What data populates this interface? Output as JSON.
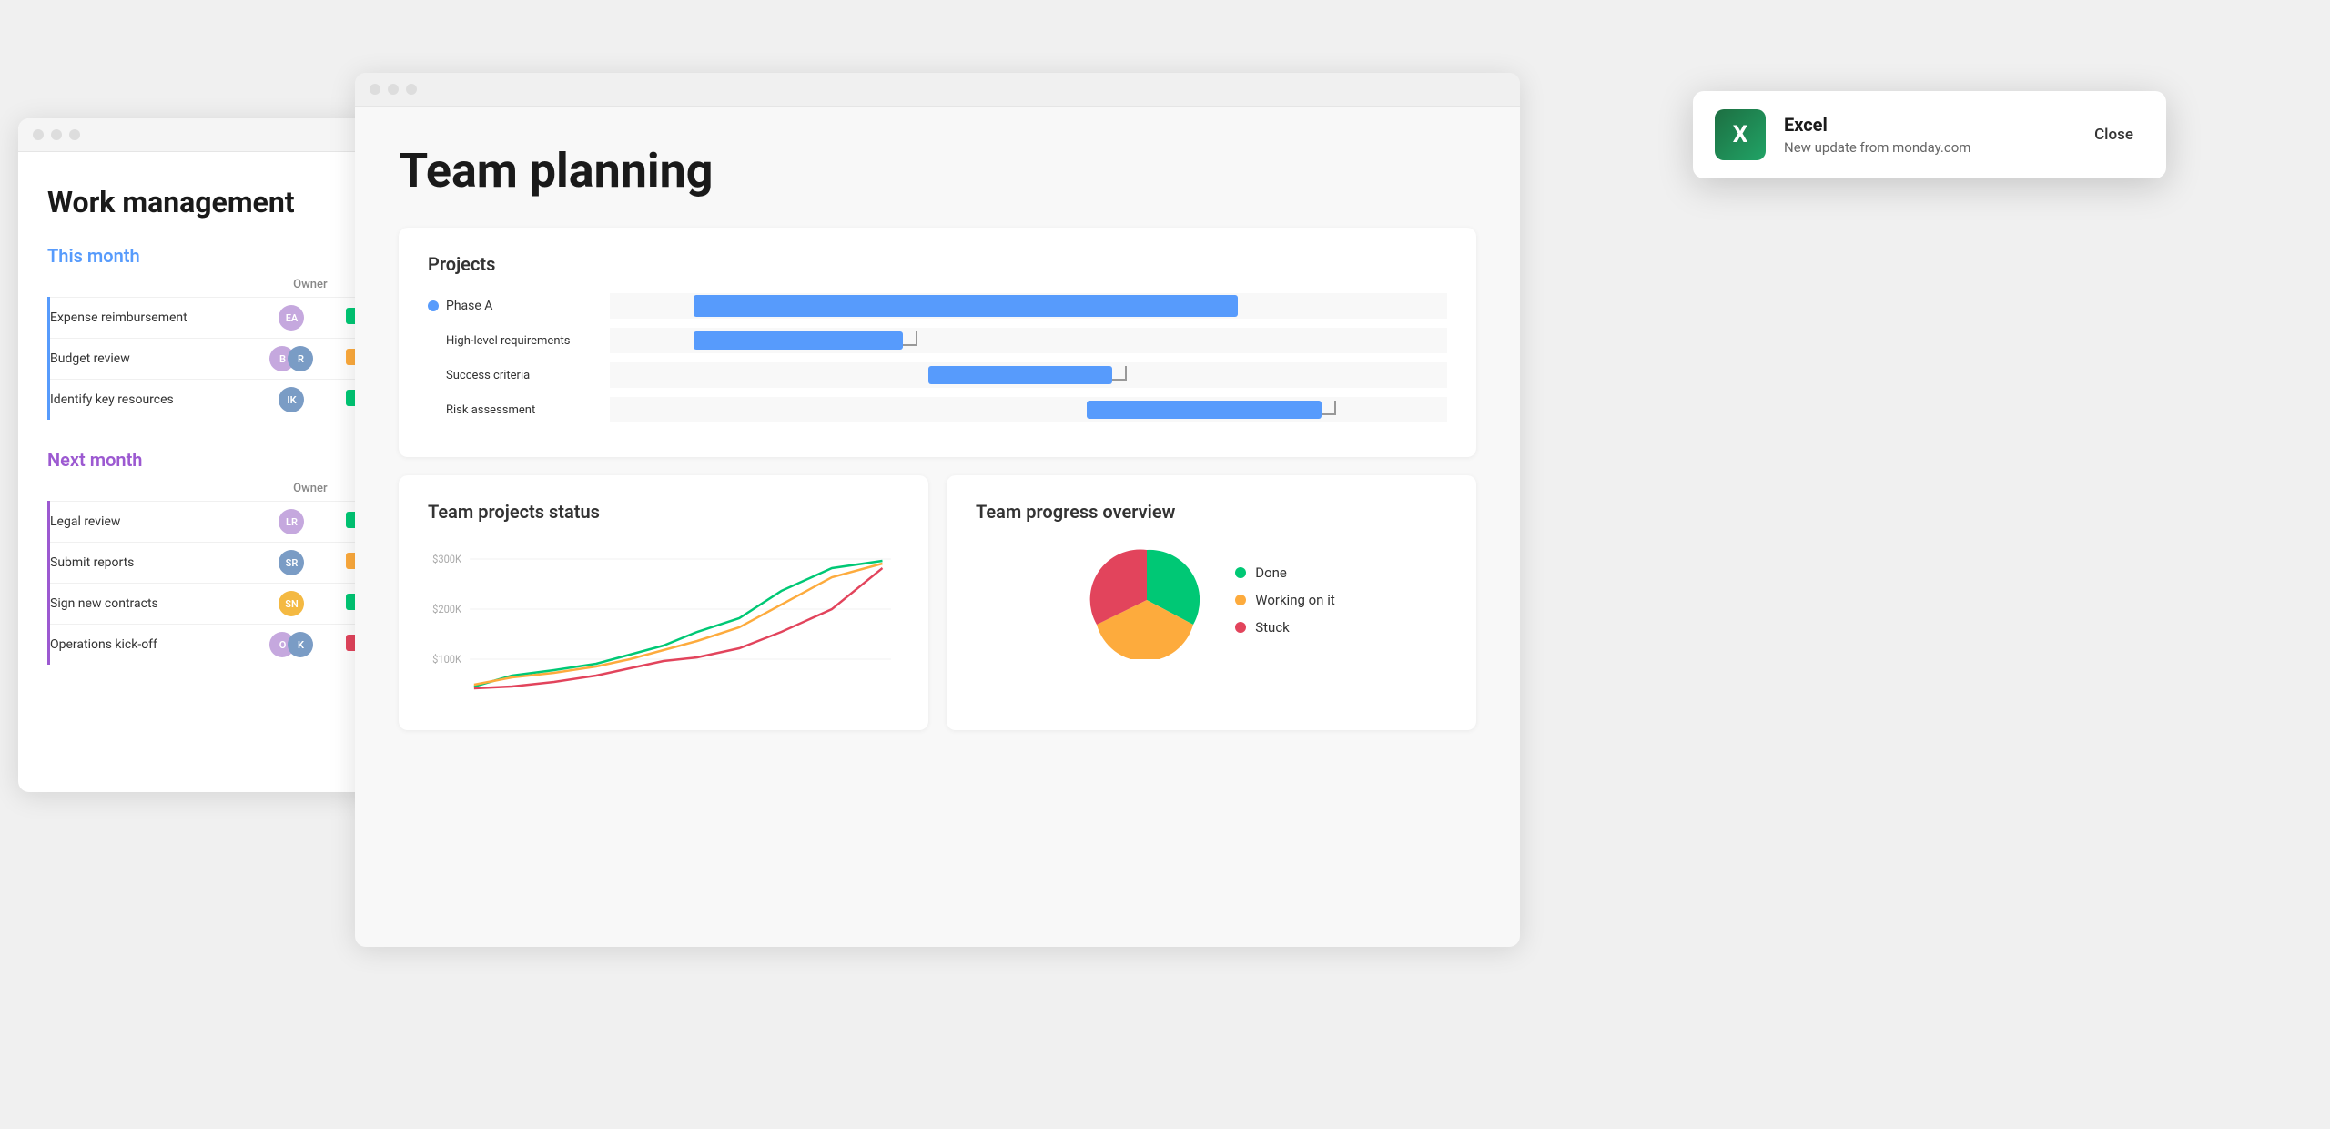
{
  "work_window": {
    "title": "Work management",
    "this_month": {
      "label": "This month",
      "owner_col": "Owner",
      "tasks": [
        {
          "name": "Expense reimbursement",
          "avatar": "EA",
          "avatar_color": "#c5a8de",
          "status": "green"
        },
        {
          "name": "Budget review",
          "avatar": "BR",
          "avatar_color": "#f4b942",
          "status": "orange"
        },
        {
          "name": "Identify key resources",
          "avatar": "IK",
          "avatar_color": "#7a9cc5",
          "status": "green"
        }
      ]
    },
    "next_month": {
      "label": "Next month",
      "owner_col": "Owner",
      "tasks": [
        {
          "name": "Legal review",
          "avatar": "LR",
          "avatar_color": "#c5a8de",
          "status": "green"
        },
        {
          "name": "Submit reports",
          "avatar": "SR",
          "avatar_color": "#7a9cc5",
          "status": "orange"
        },
        {
          "name": "Sign new contracts",
          "avatar": "SN",
          "avatar_color": "#f4b942",
          "status": "green"
        },
        {
          "name": "Operations kick-off",
          "avatar": "OK",
          "avatar_color": "#c5a8de",
          "status": "red"
        }
      ]
    }
  },
  "team_window": {
    "title": "Team planning",
    "projects_card": {
      "title": "Projects",
      "gantt_rows": [
        {
          "label": "Phase A",
          "is_phase": true,
          "bar_left": "17%",
          "bar_width": "53%"
        },
        {
          "label": "High-level requirements",
          "is_phase": false,
          "bar_left": "17%",
          "bar_width": "22%"
        },
        {
          "label": "Success criteria",
          "is_phase": false,
          "bar_left": "37%",
          "bar_width": "18%"
        },
        {
          "label": "Risk assessment",
          "is_phase": false,
          "bar_left": "55%",
          "bar_width": "26%"
        }
      ]
    },
    "status_card": {
      "title": "Team projects status",
      "y_labels": [
        "$300K",
        "$200K",
        "$100K"
      ]
    },
    "progress_card": {
      "title": "Team progress overview",
      "legend": [
        {
          "label": "Done",
          "color": "#00c875"
        },
        {
          "label": "Working on it",
          "color": "#fdab3d"
        },
        {
          "label": "Stuck",
          "color": "#e2445c"
        }
      ],
      "pie": {
        "done_pct": 35,
        "working_pct": 40,
        "stuck_pct": 25
      }
    }
  },
  "notification": {
    "app_name": "Excel",
    "message": "New update from monday.com",
    "close_label": "Close",
    "icon_letter": "X"
  }
}
